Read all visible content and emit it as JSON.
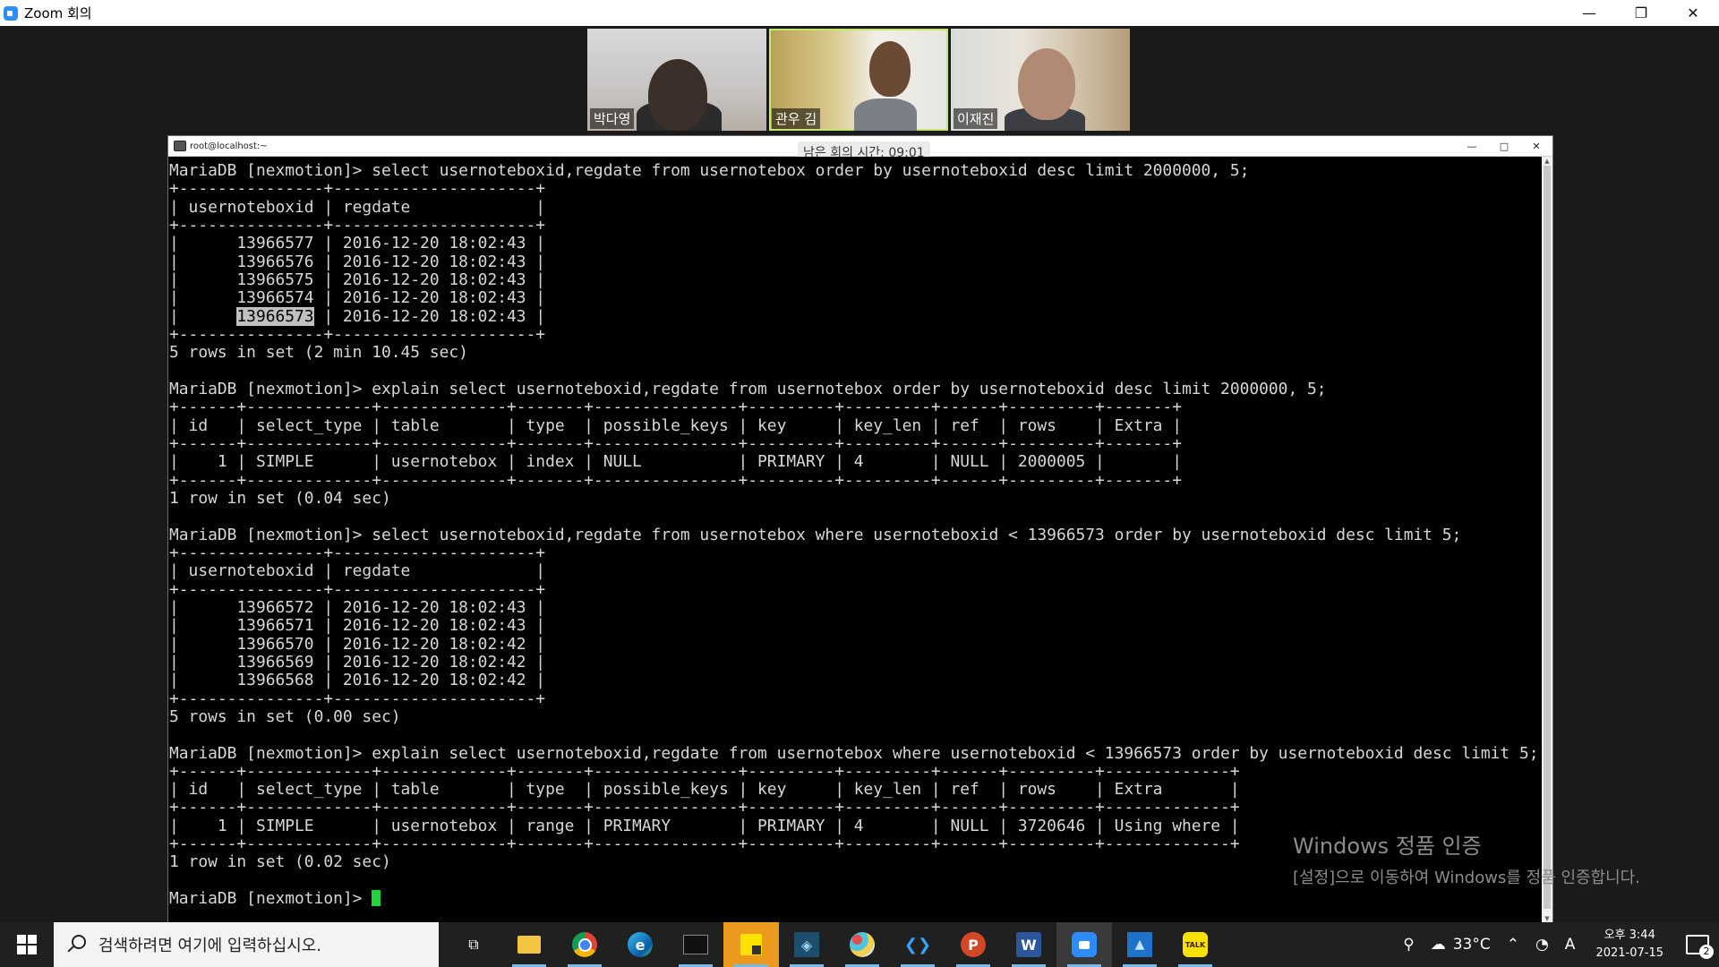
{
  "zoom": {
    "title": "Zoom 회의",
    "controls": {
      "minimize": "—",
      "restore": "❐",
      "close": "✕"
    },
    "participants": [
      {
        "name": "박다영"
      },
      {
        "name": "관우 김"
      },
      {
        "name": "이재진"
      }
    ],
    "timer": "남은 회의 시간: 09:01"
  },
  "terminal": {
    "title": "root@localhost:~",
    "controls": {
      "minimize": "—",
      "maximize": "□",
      "close": "✕"
    },
    "lines_before_highlight": "MariaDB [nexmotion]> select usernoteboxid,regdate from usernotebox order by usernoteboxid desc limit 2000000, 5;\n+---------------+---------------------+\n| usernoteboxid | regdate             |\n+---------------+---------------------+\n|      13966577 | 2016-12-20 18:02:43 |\n|      13966576 | 2016-12-20 18:02:43 |\n|      13966575 | 2016-12-20 18:02:43 |\n|      13966574 | 2016-12-20 18:02:43 |\n|      ",
    "highlight": "13966573",
    "lines_after_highlight": " | 2016-12-20 18:02:43 |\n+---------------+---------------------+\n5 rows in set (2 min 10.45 sec)\n\nMariaDB [nexmotion]> explain select usernoteboxid,regdate from usernotebox order by usernoteboxid desc limit 2000000, 5;\n+------+-------------+-------------+-------+---------------+---------+---------+------+---------+-------+\n| id   | select_type | table       | type  | possible_keys | key     | key_len | ref  | rows    | Extra |\n+------+-------------+-------------+-------+---------------+---------+---------+------+---------+-------+\n|    1 | SIMPLE      | usernotebox | index | NULL          | PRIMARY | 4       | NULL | 2000005 |       |\n+------+-------------+-------------+-------+---------------+---------+---------+------+---------+-------+\n1 row in set (0.04 sec)\n\nMariaDB [nexmotion]> select usernoteboxid,regdate from usernotebox where usernoteboxid < 13966573 order by usernoteboxid desc limit 5;\n+---------------+---------------------+\n| usernoteboxid | regdate             |\n+---------------+---------------------+\n|      13966572 | 2016-12-20 18:02:43 |\n|      13966571 | 2016-12-20 18:02:43 |\n|      13966570 | 2016-12-20 18:02:42 |\n|      13966569 | 2016-12-20 18:02:42 |\n|      13966568 | 2016-12-20 18:02:42 |\n+---------------+---------------------+\n5 rows in set (0.00 sec)\n\nMariaDB [nexmotion]> explain select usernoteboxid,regdate from usernotebox where usernoteboxid < 13966573 order by usernoteboxid desc limit 5;\n+------+-------------+-------------+-------+---------------+---------+---------+------+---------+-------------+\n| id   | select_type | table       | type  | possible_keys | key     | key_len | ref  | rows    | Extra       |\n+------+-------------+-------------+-------+---------------+---------+---------+------+---------+-------------+\n|    1 | SIMPLE      | usernotebox | range | PRIMARY       | PRIMARY | 4       | NULL | 3720646 | Using where |\n+------+-------------+-------------+-------+---------------+---------+---------+------+---------+-------------+\n1 row in set (0.02 sec)\n\n",
    "prompt": "MariaDB [nexmotion]> "
  },
  "watermark": {
    "line1": "Windows 정품 인증",
    "line2": "[설정]으로 이동하여 Windows를 정품 인증합니다."
  },
  "taskbar": {
    "search_placeholder": "검색하려면 여기에 입력하십시오.",
    "apps": [
      {
        "name": "task-view",
        "glyph": "⧉"
      },
      {
        "name": "file-explorer",
        "glyph": "📁"
      },
      {
        "name": "chrome",
        "glyph": "◉"
      },
      {
        "name": "edge",
        "glyph": "e"
      },
      {
        "name": "terminal",
        "glyph": "▭"
      },
      {
        "name": "sticky-notes",
        "glyph": "▰"
      },
      {
        "name": "mysql-workbench",
        "glyph": "◈"
      },
      {
        "name": "paint",
        "glyph": "✎"
      },
      {
        "name": "vscode",
        "glyph": "❮❯"
      },
      {
        "name": "powerpoint",
        "glyph": "P"
      },
      {
        "name": "word",
        "glyph": "W"
      },
      {
        "name": "zoom",
        "glyph": "■"
      },
      {
        "name": "photos",
        "glyph": "▲"
      },
      {
        "name": "kakaotalk",
        "glyph": "TALK"
      }
    ],
    "temperature": "33°C",
    "ime": "A",
    "clock_time": "오후 3:44",
    "clock_date": "2021-07-15",
    "notification_count": "2"
  },
  "colors": {
    "terminal_bg": "#000000",
    "terminal_text": "#d7d7d7",
    "cursor": "#22d33c",
    "taskbar_bg": "#202020",
    "zoom_accent": "#2d8cff"
  }
}
